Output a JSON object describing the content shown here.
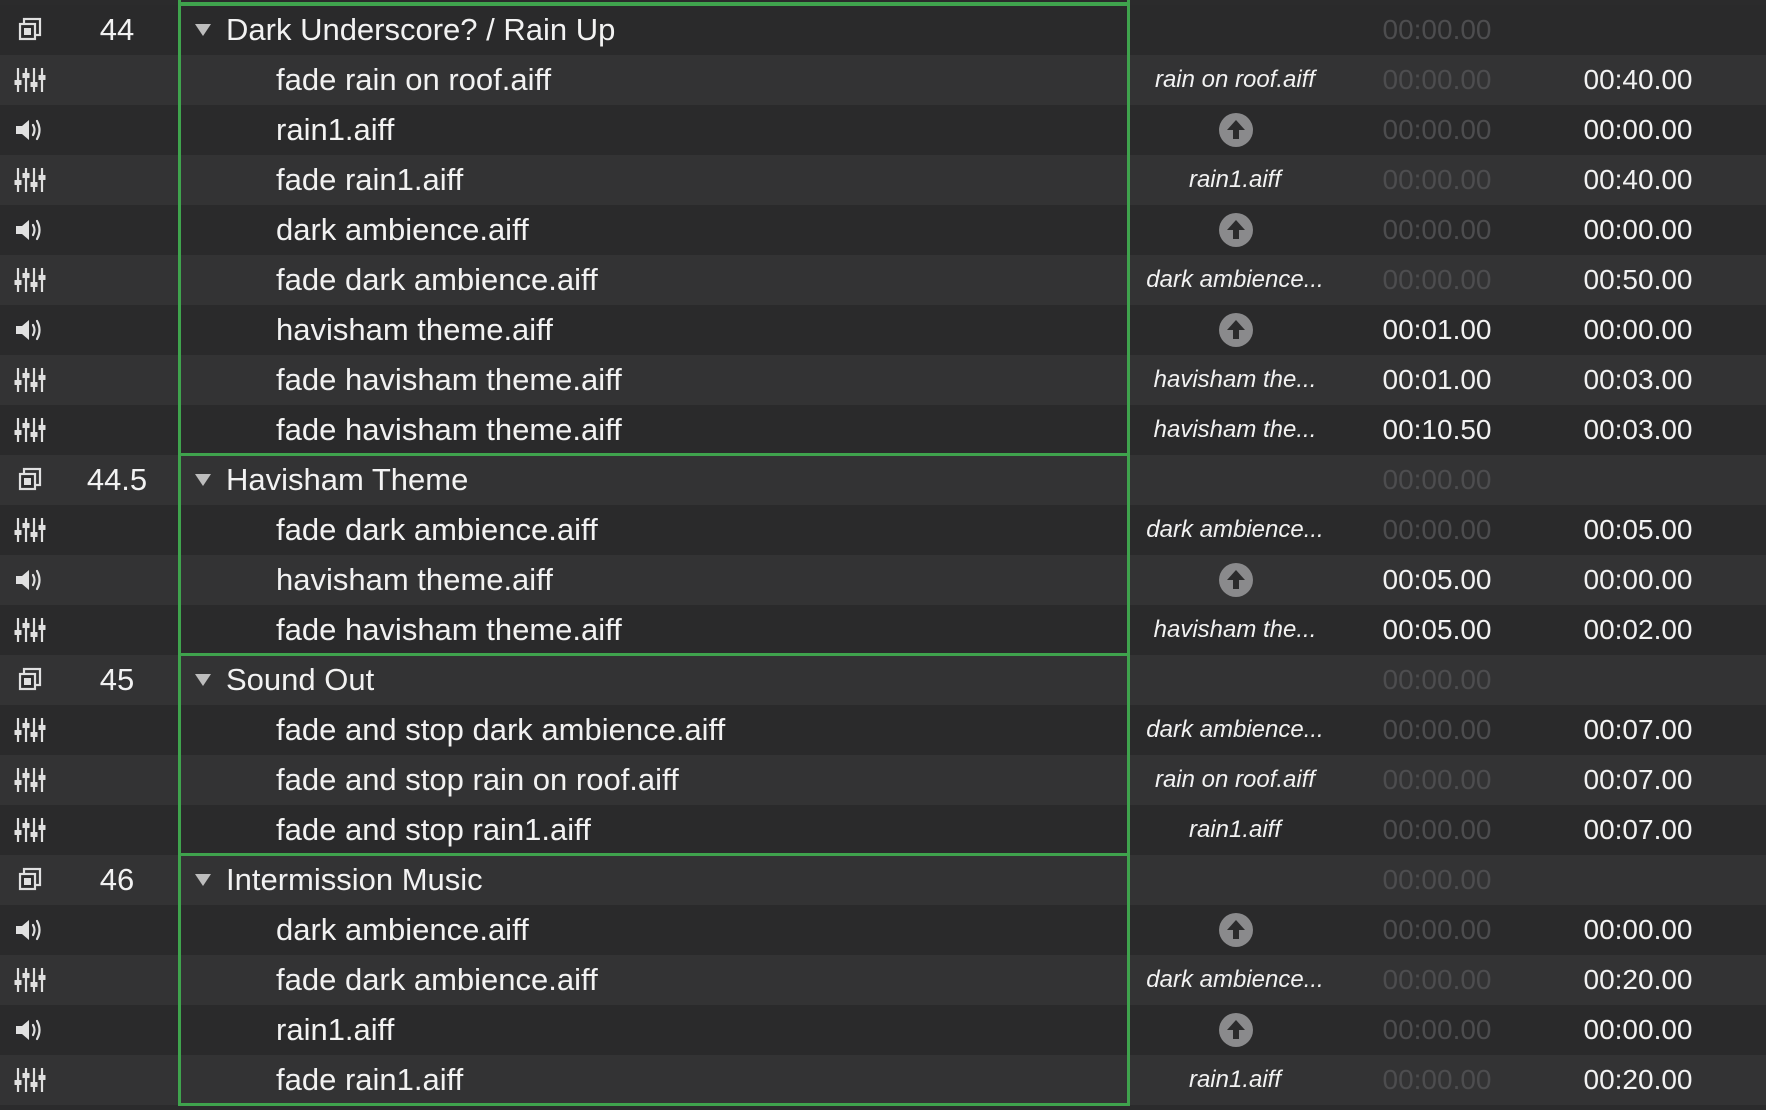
{
  "colors": {
    "group_border": "#3fa34d",
    "row_even": "#333334",
    "row_odd": "#2a2a2b",
    "text": "#f2f2f2",
    "text_dim": "#4d4d4f",
    "target_button": "#8a8a8c"
  },
  "rows": [
    {
      "kind": "group",
      "icon": "group-icon",
      "number": "44",
      "name": "Dark Underscore? / Rain Up",
      "target": "",
      "target_button": false,
      "prewait": "00:00.00",
      "prewait_dim": true,
      "duration": ""
    },
    {
      "kind": "child",
      "icon": "fade-icon",
      "number": "",
      "name": "fade rain on roof.aiff",
      "target": "rain on roof.aiff",
      "target_button": false,
      "prewait": "00:00.00",
      "prewait_dim": true,
      "duration": "00:40.00"
    },
    {
      "kind": "child",
      "icon": "audio-icon",
      "number": "",
      "name": "rain1.aiff",
      "target": "",
      "target_button": true,
      "prewait": "00:00.00",
      "prewait_dim": true,
      "duration": "00:00.00"
    },
    {
      "kind": "child",
      "icon": "fade-icon",
      "number": "",
      "name": "fade rain1.aiff",
      "target": "rain1.aiff",
      "target_button": false,
      "prewait": "00:00.00",
      "prewait_dim": true,
      "duration": "00:40.00"
    },
    {
      "kind": "child",
      "icon": "audio-icon",
      "number": "",
      "name": "dark ambience.aiff",
      "target": "",
      "target_button": true,
      "prewait": "00:00.00",
      "prewait_dim": true,
      "duration": "00:00.00"
    },
    {
      "kind": "child",
      "icon": "fade-icon",
      "number": "",
      "name": "fade dark ambience.aiff",
      "target": "dark ambience...",
      "target_button": false,
      "prewait": "00:00.00",
      "prewait_dim": true,
      "duration": "00:50.00"
    },
    {
      "kind": "child",
      "icon": "audio-icon",
      "number": "",
      "name": "havisham theme.aiff",
      "target": "",
      "target_button": true,
      "prewait": "00:01.00",
      "prewait_dim": false,
      "duration": "00:00.00"
    },
    {
      "kind": "child",
      "icon": "fade-icon",
      "number": "",
      "name": "fade havisham theme.aiff",
      "target": "havisham the...",
      "target_button": false,
      "prewait": "00:01.00",
      "prewait_dim": false,
      "duration": "00:03.00"
    },
    {
      "kind": "child",
      "icon": "fade-icon",
      "number": "",
      "name": "fade havisham theme.aiff",
      "target": "havisham the...",
      "target_button": false,
      "prewait": "00:10.50",
      "prewait_dim": false,
      "duration": "00:03.00"
    },
    {
      "kind": "group",
      "icon": "group-icon",
      "number": "44.5",
      "name": "Havisham Theme",
      "target": "",
      "target_button": false,
      "prewait": "00:00.00",
      "prewait_dim": true,
      "duration": ""
    },
    {
      "kind": "child",
      "icon": "fade-icon",
      "number": "",
      "name": "fade dark ambience.aiff",
      "target": "dark ambience...",
      "target_button": false,
      "prewait": "00:00.00",
      "prewait_dim": true,
      "duration": "00:05.00"
    },
    {
      "kind": "child",
      "icon": "audio-icon",
      "number": "",
      "name": "havisham theme.aiff",
      "target": "",
      "target_button": true,
      "prewait": "00:05.00",
      "prewait_dim": false,
      "duration": "00:00.00"
    },
    {
      "kind": "child",
      "icon": "fade-icon",
      "number": "",
      "name": "fade havisham theme.aiff",
      "target": "havisham the...",
      "target_button": false,
      "prewait": "00:05.00",
      "prewait_dim": false,
      "duration": "00:02.00"
    },
    {
      "kind": "group",
      "icon": "group-icon",
      "number": "45",
      "name": "Sound Out",
      "target": "",
      "target_button": false,
      "prewait": "00:00.00",
      "prewait_dim": true,
      "duration": ""
    },
    {
      "kind": "child",
      "icon": "fade-icon",
      "number": "",
      "name": "fade and stop dark ambience.aiff",
      "target": "dark ambience...",
      "target_button": false,
      "prewait": "00:00.00",
      "prewait_dim": true,
      "duration": "00:07.00"
    },
    {
      "kind": "child",
      "icon": "fade-icon",
      "number": "",
      "name": "fade and stop rain on roof.aiff",
      "target": "rain on roof.aiff",
      "target_button": false,
      "prewait": "00:00.00",
      "prewait_dim": true,
      "duration": "00:07.00"
    },
    {
      "kind": "child",
      "icon": "fade-icon",
      "number": "",
      "name": "fade and stop rain1.aiff",
      "target": "rain1.aiff",
      "target_button": false,
      "prewait": "00:00.00",
      "prewait_dim": true,
      "duration": "00:07.00"
    },
    {
      "kind": "group",
      "icon": "group-icon",
      "number": "46",
      "name": "Intermission Music",
      "target": "",
      "target_button": false,
      "prewait": "00:00.00",
      "prewait_dim": true,
      "duration": ""
    },
    {
      "kind": "child",
      "icon": "audio-icon",
      "number": "",
      "name": "dark ambience.aiff",
      "target": "",
      "target_button": true,
      "prewait": "00:00.00",
      "prewait_dim": true,
      "duration": "00:00.00"
    },
    {
      "kind": "child",
      "icon": "fade-icon",
      "number": "",
      "name": "fade dark ambience.aiff",
      "target": "dark ambience...",
      "target_button": false,
      "prewait": "00:00.00",
      "prewait_dim": true,
      "duration": "00:20.00"
    },
    {
      "kind": "child",
      "icon": "audio-icon",
      "number": "",
      "name": "rain1.aiff",
      "target": "",
      "target_button": true,
      "prewait": "00:00.00",
      "prewait_dim": true,
      "duration": "00:00.00"
    },
    {
      "kind": "child",
      "icon": "fade-icon",
      "number": "",
      "name": "fade rain1.aiff",
      "target": "rain1.aiff",
      "target_button": false,
      "prewait": "00:00.00",
      "prewait_dim": true,
      "duration": "00:20.00"
    }
  ]
}
